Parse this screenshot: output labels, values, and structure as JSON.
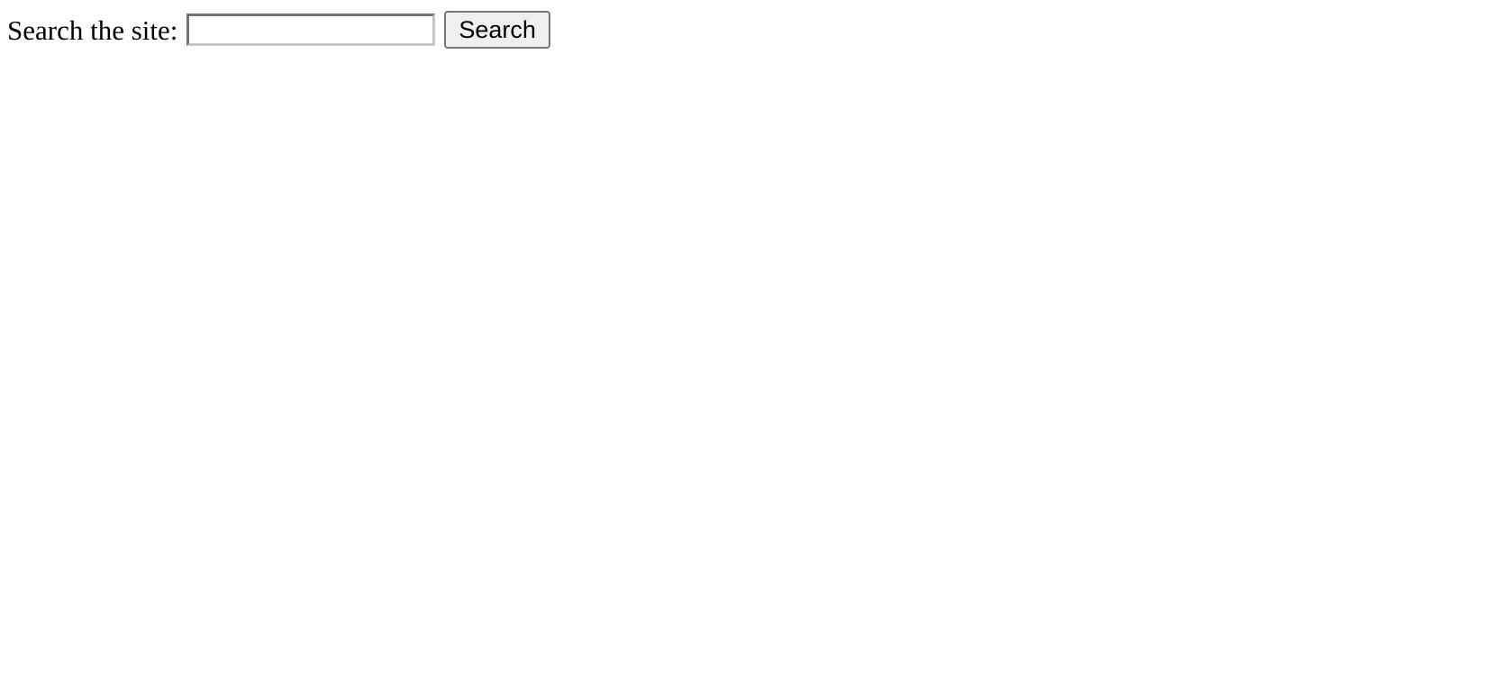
{
  "search": {
    "label": "Search the site:",
    "value": "",
    "placeholder": "",
    "button_label": "Search"
  }
}
